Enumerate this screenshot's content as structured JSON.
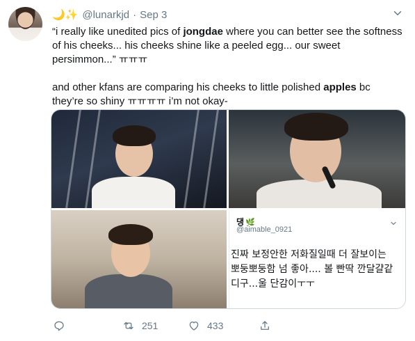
{
  "tweet": {
    "emoji": "🌙✨",
    "handle": "@lunarkjd",
    "separator": "·",
    "date": "Sep 3",
    "text": {
      "p1_a": "“i really like unedited pics of ",
      "p1_bold": "jongdae",
      "p1_b": " where you can better see the softness of his cheeks... his cheeks shine like a peeled egg... our sweet persimmon...” ㅠㅠㅠ",
      "p2_a": "and other kfans are comparing his cheeks to little polished ",
      "p2_bold": "apples",
      "p2_b": " bc they’re so shiny ㅠㅠㅠㅠ i’m not okay-"
    }
  },
  "quoted": {
    "name": "댕",
    "leaf": "🌿",
    "handle": "@aimable_0921",
    "text": "진짜 보정안한 저화질일때 더 잘보이는\n뽀둥뽀둥함 넘 좋아.... 볼 빤딱 깐달걀같\n디구...울 단감이ㅜㅜ"
  },
  "actions": {
    "reply_count": "",
    "retweet_count": "251",
    "like_count": "433"
  },
  "icons": {
    "caret": "chevron-down-icon",
    "reply": "reply-icon",
    "retweet": "retweet-icon",
    "like": "heart-icon",
    "share": "share-icon"
  },
  "colors": {
    "text": "#14171a",
    "muted": "#657786",
    "border": "#ccd6dd"
  }
}
